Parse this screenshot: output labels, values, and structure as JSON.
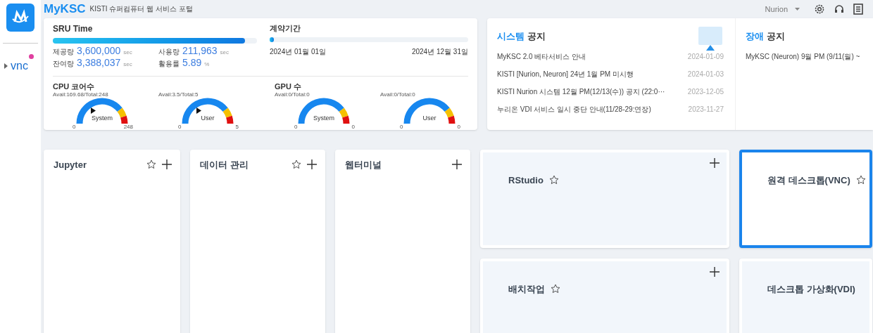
{
  "app": {
    "title": "MyKSC",
    "subtitle": "KISTI 슈퍼컴퓨터 웹 서비스 포털"
  },
  "sidebar": {
    "items": [
      {
        "label": "vnc",
        "badge": true
      }
    ]
  },
  "header": {
    "cluster": "Nurion"
  },
  "sru": {
    "title": "SRU Time",
    "level": 0.94,
    "stats": [
      {
        "label": "제공량",
        "value": "3,600,000",
        "unit": "sec"
      },
      {
        "label": "사용량",
        "value": "211,963",
        "unit": "sec"
      },
      {
        "label": "잔여량",
        "value": "3,388,037",
        "unit": "sec"
      },
      {
        "label": "활용률",
        "value": "5.89",
        "unit": "%"
      }
    ]
  },
  "contract": {
    "title": "계약기간",
    "level": 0.02,
    "start": "2024년 01월 01일",
    "end": "2024년 12월 31일"
  },
  "resources": [
    {
      "title": "CPU 코어수",
      "gauges": [
        {
          "caption": "Avail:169.68/Total:248",
          "label": "System",
          "min": "0",
          "max": "248",
          "pointer": true
        },
        {
          "caption": "Avail:3.5/Total:5",
          "label": "User",
          "min": "0",
          "max": "5",
          "pointer": true
        }
      ]
    },
    {
      "title": "GPU 수",
      "gauges": [
        {
          "caption": "Avail:0/Total:0",
          "label": "System",
          "min": "0",
          "max": "0",
          "pointer": false
        },
        {
          "caption": "Avail:0/Total:0",
          "label": "User",
          "min": "0",
          "max": "0",
          "pointer": false
        }
      ]
    }
  ],
  "notices": [
    {
      "accent": "시스템",
      "title": "공지",
      "items": [
        {
          "text": "MyKSC 2.0 베타서비스 안내",
          "date": "2024-01-09"
        },
        {
          "text": "KISTI [Nurion, Neuron] 24년 1월 PM 미시행",
          "date": "2024-01-03"
        },
        {
          "text": "KISTI Nurion 시스템 12월 PM(12/13(수)) 공지 (22:0···",
          "date": "2023-12-05"
        },
        {
          "text": "누리온 VDI 서비스 일시 중단 안내(11/28-29:연장)",
          "date": "2023-11-27"
        }
      ]
    },
    {
      "accent": "장애",
      "title": "공지",
      "items": [
        {
          "text": "MyKSC (Neuron) 9월 PM (9/11(월) ~"
        }
      ]
    }
  ],
  "tiles": [
    {
      "kind": "tall",
      "title": "Jupyter",
      "star": true,
      "plus": true,
      "selected": false
    },
    {
      "kind": "tall",
      "title": "데이터 관리",
      "star": true,
      "plus": true,
      "selected": false
    },
    {
      "kind": "tall",
      "title": "웹터미널",
      "star": false,
      "plus": true,
      "selected": false
    },
    {
      "kind": "wide",
      "title": "RStudio",
      "star": true,
      "plus": true,
      "selected": false
    },
    {
      "kind": "wide",
      "title": "원격 데스크톱(VNC)",
      "star": true,
      "plus": false,
      "selected": true
    },
    {
      "kind": "wide",
      "title": "배치작업",
      "star": true,
      "plus": true,
      "selected": false
    },
    {
      "kind": "wide",
      "title": "데스크톱 가상화(VDI)",
      "star": false,
      "plus": false,
      "selected": false
    }
  ]
}
